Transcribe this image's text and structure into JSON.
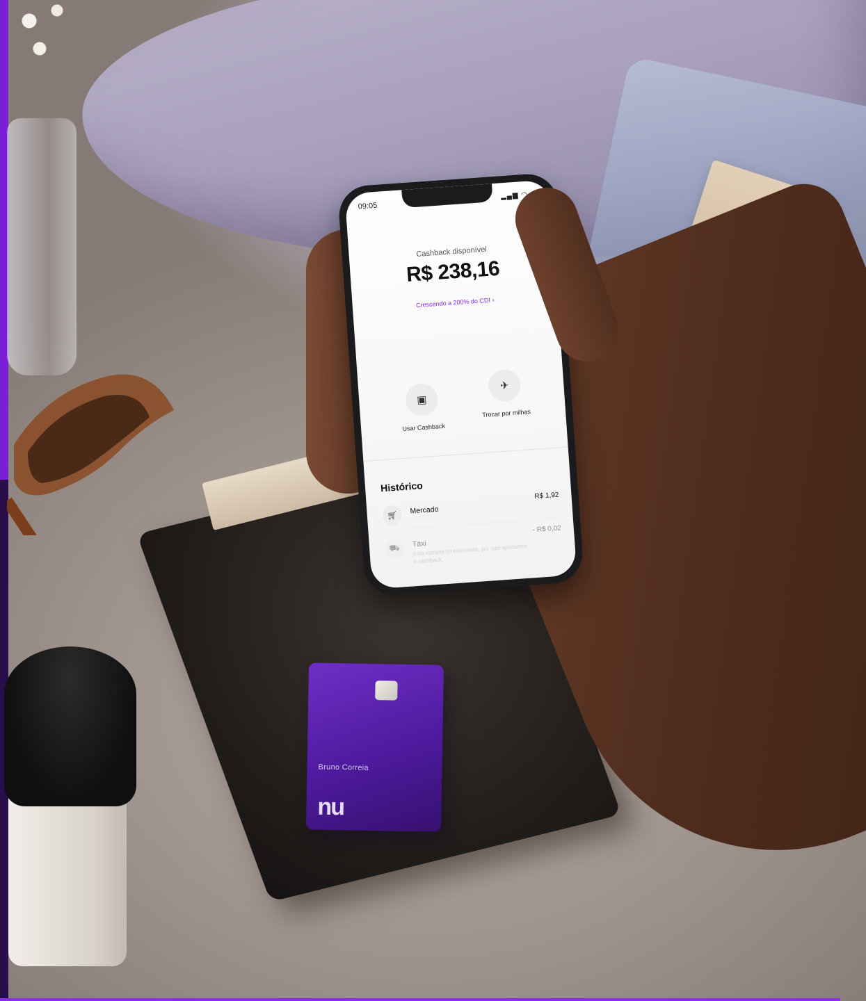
{
  "phone": {
    "status_time": "09:05",
    "cashback_label": "Cashback disponível",
    "cashback_amount": "R$ 238,16",
    "cashback_link": "Crescendo a 200% do CDI",
    "link_chevron": "›",
    "actions": [
      {
        "label": "Usar Cashback",
        "icon": "cashback-icon"
      },
      {
        "label": "Trocar por milhas",
        "icon": "airplane-icon"
      }
    ],
    "history_title": "Histórico",
    "history": [
      {
        "name": "Mercado",
        "value": "R$ 1,92",
        "icon": "cart-icon",
        "description": ""
      },
      {
        "name": "Táxi",
        "value": "- R$ 0,02",
        "icon": "car-icon",
        "description": "Esta compra foi estornada, por isso ajustamos o cashback."
      }
    ]
  },
  "card": {
    "holder_name": "Bruno Correia",
    "brand_logo": "nu"
  },
  "colors": {
    "brand_purple": "#820ad1",
    "link_purple": "#8a2be2",
    "edge_purple": "#7a1fd6"
  }
}
